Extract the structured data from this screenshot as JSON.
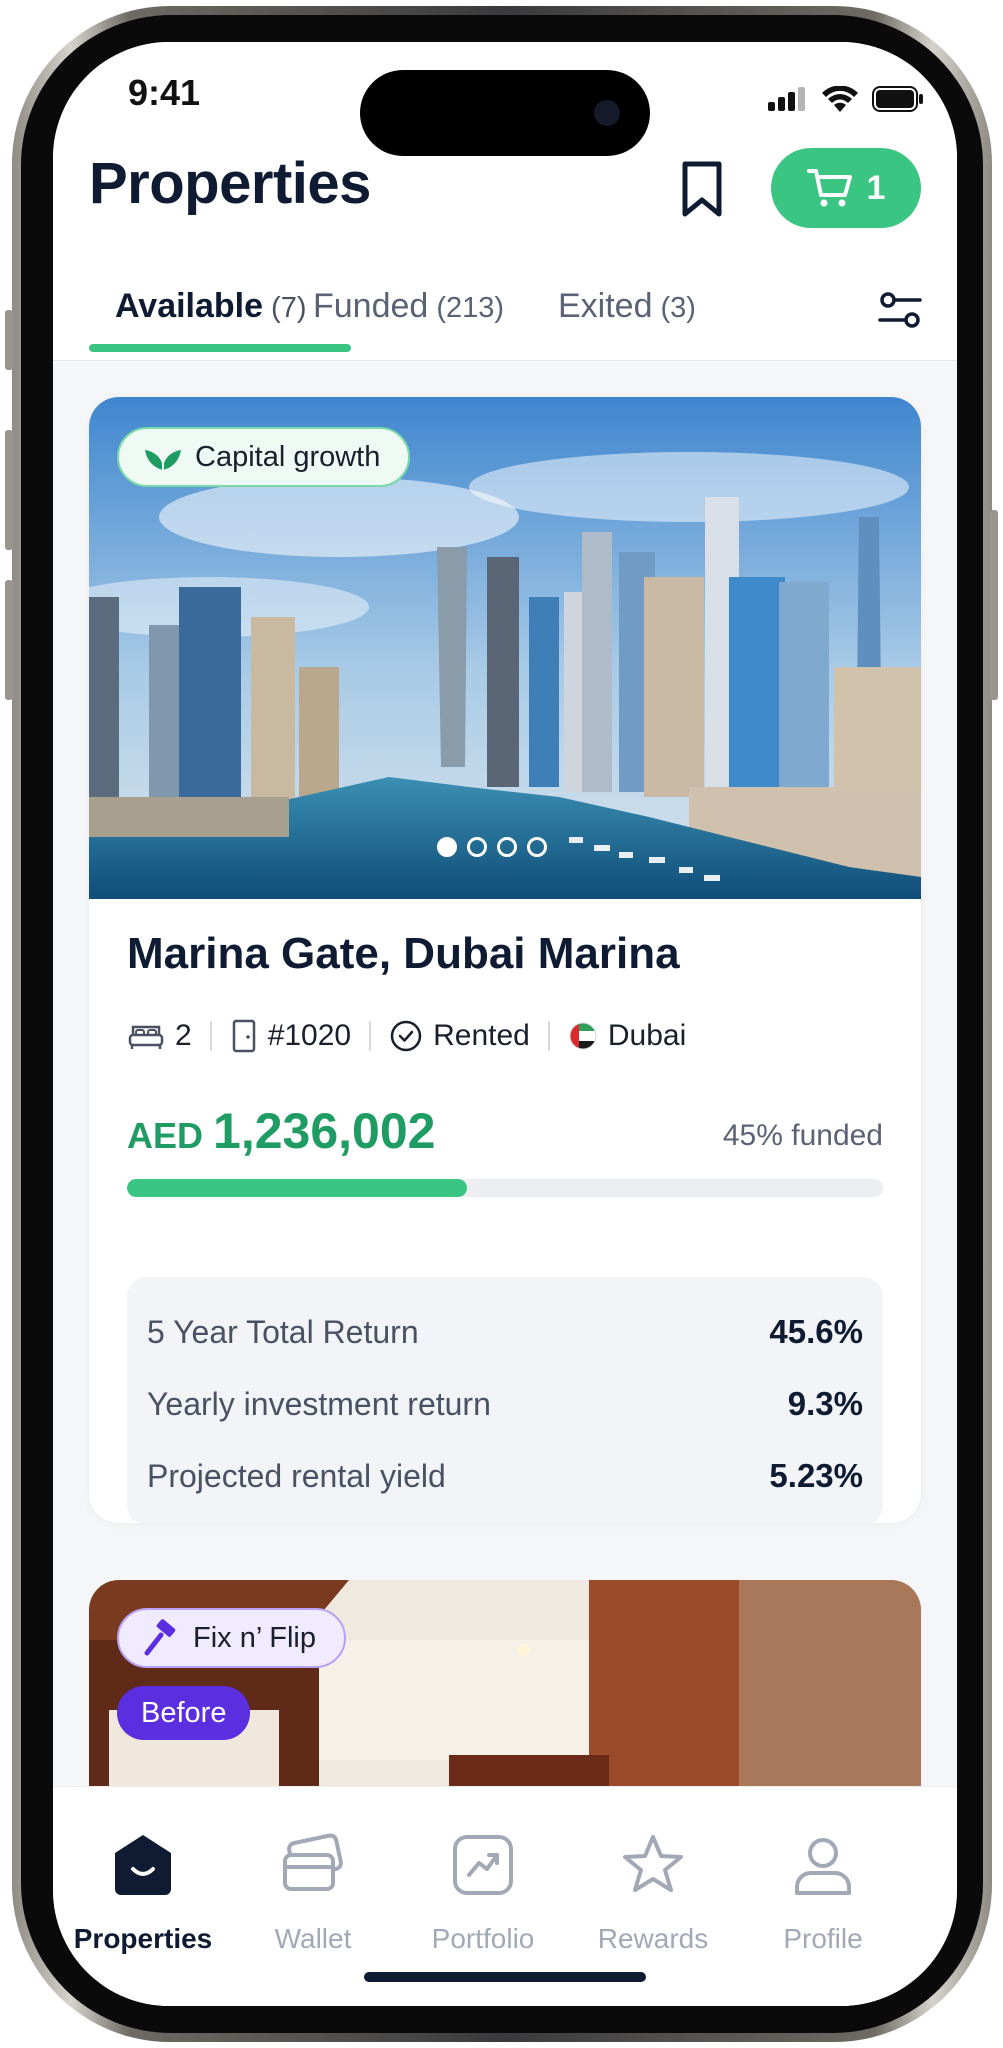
{
  "status_bar": {
    "time": "9:41"
  },
  "header": {
    "title": "Properties",
    "cart_count": "1",
    "bookmark_icon": "bookmark-icon",
    "cart_icon": "cart-icon"
  },
  "tabs": [
    {
      "label": "Available",
      "count": "(7)"
    },
    {
      "label": "Funded",
      "count": "(213)"
    },
    {
      "label": "Exited",
      "count": "(3)"
    }
  ],
  "listing": {
    "badge": "Capital growth",
    "title": "Marina Gate, Dubai Marina",
    "meta": {
      "bedrooms": "2",
      "unit": "#1020",
      "status": "Rented",
      "city": "Dubai"
    },
    "currency": "AED",
    "price": "1,236,002",
    "funded_text": "45% funded",
    "funded_fraction": 0.45,
    "carousel": {
      "total": 4,
      "active": 1
    },
    "returns": [
      {
        "label": "5 Year Total Return",
        "value": "45.6%"
      },
      {
        "label": "Yearly investment return",
        "value": "9.3%"
      },
      {
        "label": "Projected rental yield",
        "value": "5.23%"
      }
    ]
  },
  "listing2": {
    "badge": "Fix n’ Flip",
    "pill": "Before"
  },
  "nav": [
    {
      "label": "Properties",
      "icon": "properties-icon",
      "active": true
    },
    {
      "label": "Wallet",
      "icon": "wallet-icon",
      "active": false
    },
    {
      "label": "Portfolio",
      "icon": "portfolio-icon",
      "active": false
    },
    {
      "label": "Rewards",
      "icon": "star-icon",
      "active": false
    },
    {
      "label": "Profile",
      "icon": "profile-icon",
      "active": false
    }
  ],
  "colors": {
    "accent": "#3bc582",
    "price": "#1e9c63",
    "purple": "#5b2ee0",
    "text": "#0f1b33"
  }
}
